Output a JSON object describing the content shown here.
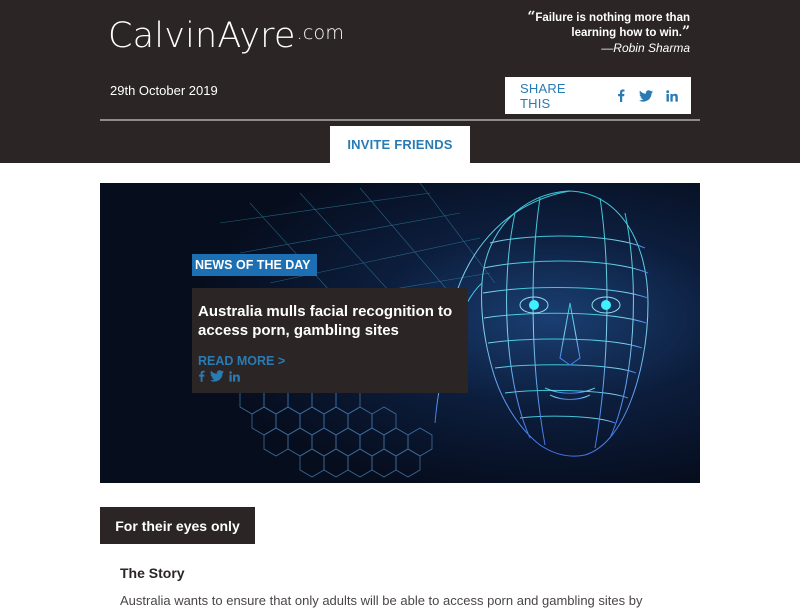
{
  "header": {
    "logo_main": "CalvinAyre",
    "logo_suffix": ".com",
    "quote_open": "“",
    "quote_text": "Failure is nothing more than learning how to win.",
    "quote_close": "”",
    "quote_author": "—Robin Sharma",
    "date": "29th October 2019",
    "share_label": "SHARE THIS",
    "share_icons": [
      "facebook-icon",
      "twitter-icon",
      "linkedin-icon"
    ],
    "invite_label": "INVITE FRIENDS"
  },
  "hero": {
    "tag": "NEWS OF THE DAY",
    "title": "Australia mulls facial recognition to access porn, gambling sites",
    "read_more": "READ MORE >",
    "social_icons": [
      "facebook-icon",
      "twitter-icon",
      "linkedin-icon"
    ]
  },
  "section": {
    "label": "For their eyes only",
    "story_title": "The Story",
    "story_body": "Australia wants to ensure that only adults will be able to access porn and gambling sites by"
  },
  "colors": {
    "header_bg": "#2b2526",
    "accent_blue": "#2a7bb4",
    "tag_blue": "#1b6fb2",
    "white": "#ffffff"
  }
}
